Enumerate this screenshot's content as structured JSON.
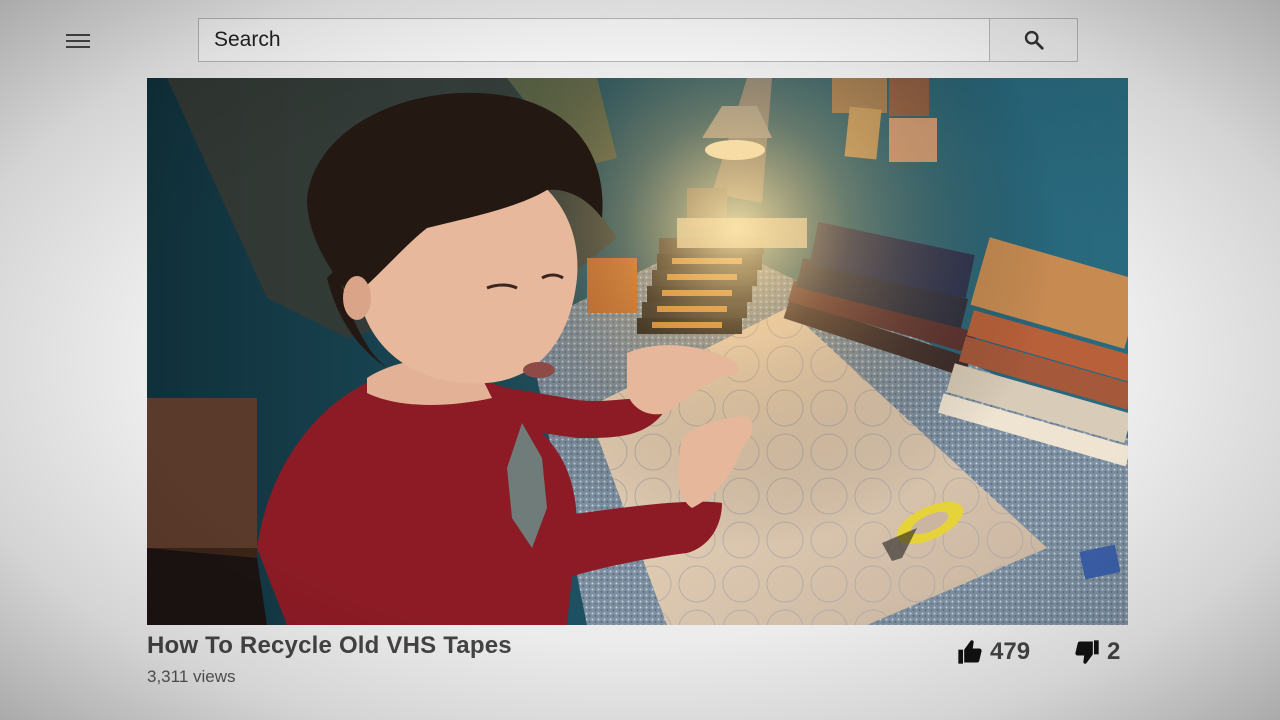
{
  "header": {
    "menu_icon": "hamburger-menu-icon",
    "search": {
      "placeholder": "Search",
      "value": "",
      "button_icon": "search-icon"
    }
  },
  "video": {
    "title": "How To Recycle Old VHS Tapes",
    "views": "3,311 views",
    "likes": "479",
    "dislikes": "2",
    "like_icon": "thumbs-up-icon",
    "dislike_icon": "thumbs-down-icon"
  },
  "colors": {
    "background": "#ececec",
    "text": "#444444",
    "search_border": "#b8b8b8"
  }
}
